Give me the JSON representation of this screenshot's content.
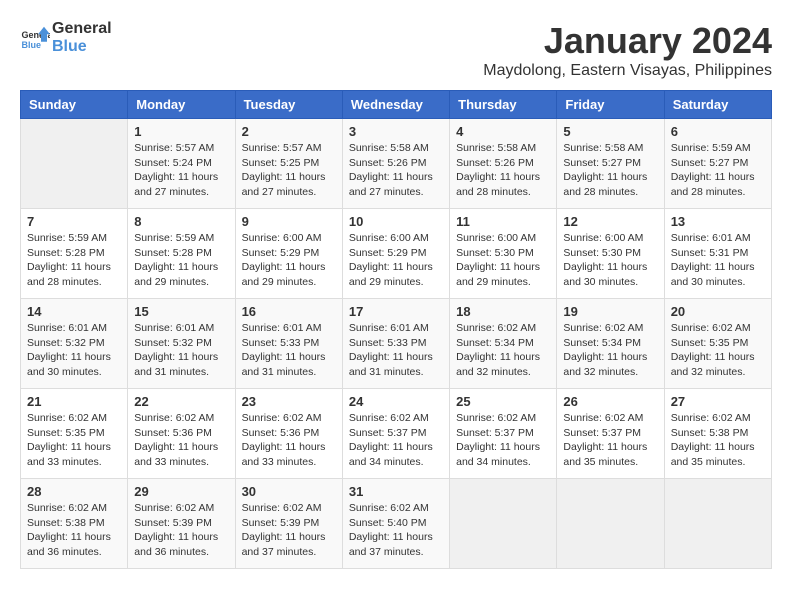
{
  "logo": {
    "text_general": "General",
    "text_blue": "Blue"
  },
  "title": "January 2024",
  "location": "Maydolong, Eastern Visayas, Philippines",
  "days_of_week": [
    "Sunday",
    "Monday",
    "Tuesday",
    "Wednesday",
    "Thursday",
    "Friday",
    "Saturday"
  ],
  "weeks": [
    [
      {
        "day": "",
        "info": ""
      },
      {
        "day": "1",
        "info": "Sunrise: 5:57 AM\nSunset: 5:24 PM\nDaylight: 11 hours\nand 27 minutes."
      },
      {
        "day": "2",
        "info": "Sunrise: 5:57 AM\nSunset: 5:25 PM\nDaylight: 11 hours\nand 27 minutes."
      },
      {
        "day": "3",
        "info": "Sunrise: 5:58 AM\nSunset: 5:26 PM\nDaylight: 11 hours\nand 27 minutes."
      },
      {
        "day": "4",
        "info": "Sunrise: 5:58 AM\nSunset: 5:26 PM\nDaylight: 11 hours\nand 28 minutes."
      },
      {
        "day": "5",
        "info": "Sunrise: 5:58 AM\nSunset: 5:27 PM\nDaylight: 11 hours\nand 28 minutes."
      },
      {
        "day": "6",
        "info": "Sunrise: 5:59 AM\nSunset: 5:27 PM\nDaylight: 11 hours\nand 28 minutes."
      }
    ],
    [
      {
        "day": "7",
        "info": "Sunrise: 5:59 AM\nSunset: 5:28 PM\nDaylight: 11 hours\nand 28 minutes."
      },
      {
        "day": "8",
        "info": "Sunrise: 5:59 AM\nSunset: 5:28 PM\nDaylight: 11 hours\nand 29 minutes."
      },
      {
        "day": "9",
        "info": "Sunrise: 6:00 AM\nSunset: 5:29 PM\nDaylight: 11 hours\nand 29 minutes."
      },
      {
        "day": "10",
        "info": "Sunrise: 6:00 AM\nSunset: 5:29 PM\nDaylight: 11 hours\nand 29 minutes."
      },
      {
        "day": "11",
        "info": "Sunrise: 6:00 AM\nSunset: 5:30 PM\nDaylight: 11 hours\nand 29 minutes."
      },
      {
        "day": "12",
        "info": "Sunrise: 6:00 AM\nSunset: 5:30 PM\nDaylight: 11 hours\nand 30 minutes."
      },
      {
        "day": "13",
        "info": "Sunrise: 6:01 AM\nSunset: 5:31 PM\nDaylight: 11 hours\nand 30 minutes."
      }
    ],
    [
      {
        "day": "14",
        "info": "Sunrise: 6:01 AM\nSunset: 5:32 PM\nDaylight: 11 hours\nand 30 minutes."
      },
      {
        "day": "15",
        "info": "Sunrise: 6:01 AM\nSunset: 5:32 PM\nDaylight: 11 hours\nand 31 minutes."
      },
      {
        "day": "16",
        "info": "Sunrise: 6:01 AM\nSunset: 5:33 PM\nDaylight: 11 hours\nand 31 minutes."
      },
      {
        "day": "17",
        "info": "Sunrise: 6:01 AM\nSunset: 5:33 PM\nDaylight: 11 hours\nand 31 minutes."
      },
      {
        "day": "18",
        "info": "Sunrise: 6:02 AM\nSunset: 5:34 PM\nDaylight: 11 hours\nand 32 minutes."
      },
      {
        "day": "19",
        "info": "Sunrise: 6:02 AM\nSunset: 5:34 PM\nDaylight: 11 hours\nand 32 minutes."
      },
      {
        "day": "20",
        "info": "Sunrise: 6:02 AM\nSunset: 5:35 PM\nDaylight: 11 hours\nand 32 minutes."
      }
    ],
    [
      {
        "day": "21",
        "info": "Sunrise: 6:02 AM\nSunset: 5:35 PM\nDaylight: 11 hours\nand 33 minutes."
      },
      {
        "day": "22",
        "info": "Sunrise: 6:02 AM\nSunset: 5:36 PM\nDaylight: 11 hours\nand 33 minutes."
      },
      {
        "day": "23",
        "info": "Sunrise: 6:02 AM\nSunset: 5:36 PM\nDaylight: 11 hours\nand 33 minutes."
      },
      {
        "day": "24",
        "info": "Sunrise: 6:02 AM\nSunset: 5:37 PM\nDaylight: 11 hours\nand 34 minutes."
      },
      {
        "day": "25",
        "info": "Sunrise: 6:02 AM\nSunset: 5:37 PM\nDaylight: 11 hours\nand 34 minutes."
      },
      {
        "day": "26",
        "info": "Sunrise: 6:02 AM\nSunset: 5:37 PM\nDaylight: 11 hours\nand 35 minutes."
      },
      {
        "day": "27",
        "info": "Sunrise: 6:02 AM\nSunset: 5:38 PM\nDaylight: 11 hours\nand 35 minutes."
      }
    ],
    [
      {
        "day": "28",
        "info": "Sunrise: 6:02 AM\nSunset: 5:38 PM\nDaylight: 11 hours\nand 36 minutes."
      },
      {
        "day": "29",
        "info": "Sunrise: 6:02 AM\nSunset: 5:39 PM\nDaylight: 11 hours\nand 36 minutes."
      },
      {
        "day": "30",
        "info": "Sunrise: 6:02 AM\nSunset: 5:39 PM\nDaylight: 11 hours\nand 37 minutes."
      },
      {
        "day": "31",
        "info": "Sunrise: 6:02 AM\nSunset: 5:40 PM\nDaylight: 11 hours\nand 37 minutes."
      },
      {
        "day": "",
        "info": ""
      },
      {
        "day": "",
        "info": ""
      },
      {
        "day": "",
        "info": ""
      }
    ]
  ]
}
